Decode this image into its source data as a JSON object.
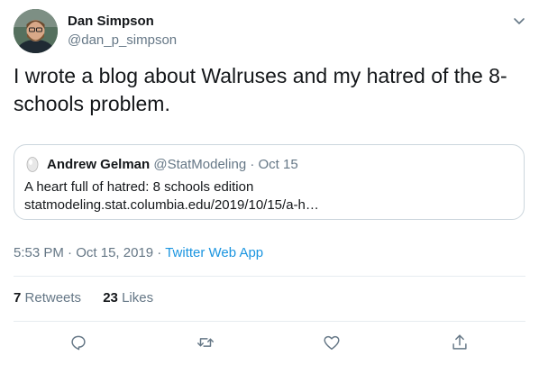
{
  "author": {
    "name": "Dan Simpson",
    "handle": "@dan_p_simpson",
    "avatar_icon": "profile-photo"
  },
  "tweet": {
    "text": "I wrote a blog about Walruses and my hatred of the 8-schools problem."
  },
  "quoted_tweet": {
    "name": "Andrew Gelman",
    "handle": "@StatModeling",
    "separator": "·",
    "date": "Oct 15",
    "text": "A heart full of hatred: 8 schools edition statmodeling.stat.columbia.edu/2019/10/15/a-h…"
  },
  "meta": {
    "time": "5:53 PM",
    "separator": "·",
    "date": "Oct 15, 2019",
    "app": "Twitter Web App"
  },
  "stats": {
    "retweets_count": "7",
    "retweets_label": "Retweets",
    "likes_count": "23",
    "likes_label": "Likes"
  },
  "actions": [
    "reply-icon",
    "retweet-icon",
    "like-icon",
    "share-icon"
  ],
  "colors": {
    "text": "#14171a",
    "secondary": "#657786",
    "link": "#1b95e0",
    "border": "#ccd6dd",
    "icon": "#657786"
  }
}
